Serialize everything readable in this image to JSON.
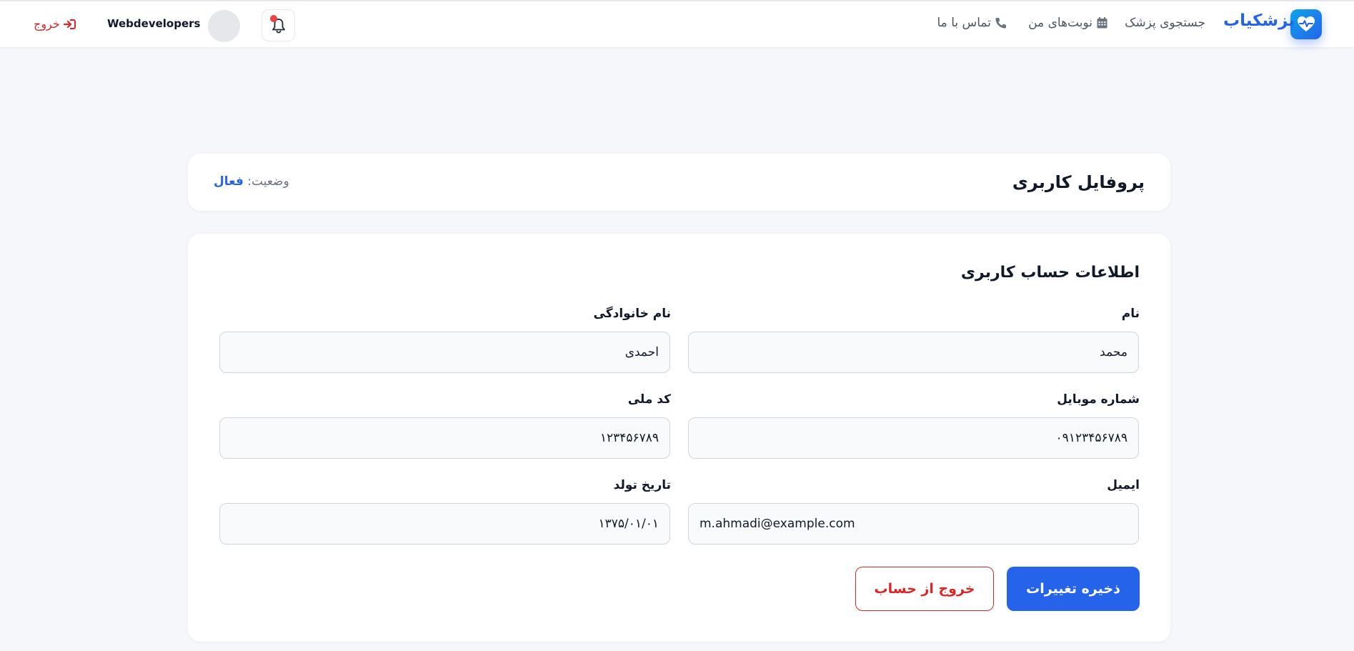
{
  "header": {
    "brand": "پزشکیاب",
    "nav": {
      "doctor_search": "جستجوی پزشک",
      "appointments": "نوبت‌های من",
      "contact": "تماس با ما"
    },
    "username": "Webdevelopers",
    "logout": "خروج"
  },
  "profile": {
    "title": "پروفایل کاربری",
    "status_label": "وضعیت:",
    "status_value": "فعال"
  },
  "form": {
    "section_title": "اطلاعات حساب کاربری",
    "fields": {
      "first_name": {
        "label": "نام",
        "value": "محمد"
      },
      "last_name": {
        "label": "نام خانوادگی",
        "value": "احمدی"
      },
      "mobile": {
        "label": "شماره موبایل",
        "value": "۰۹۱۲۳۴۵۶۷۸۹"
      },
      "national_code": {
        "label": "کد ملی",
        "value": "۱۲۳۴۵۶۷۸۹"
      },
      "email": {
        "label": "ایمیل",
        "value": "m.ahmadi@example.com"
      },
      "birth_date": {
        "label": "تاریخ تولد",
        "value": "۱۳۷۵/۰۱/۰۱"
      }
    },
    "save_button": "ذخیره تغییرات",
    "logout_button": "خروج از حساب"
  },
  "colors": {
    "primary": "#2563eb",
    "danger": "#dc2626",
    "background": "#f5f7fa"
  },
  "icons": {
    "logo": "heart-pulse-icon",
    "appointments": "calendar-icon",
    "contact": "phone-icon",
    "notifications": "bell-icon",
    "logout": "sign-out-icon"
  }
}
